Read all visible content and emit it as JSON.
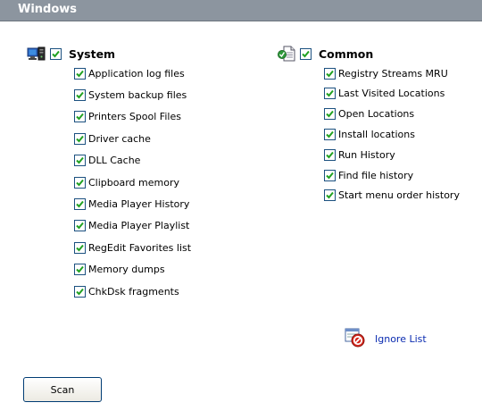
{
  "window": {
    "title": "Windows"
  },
  "system": {
    "header": "System",
    "icon": "computer-icon",
    "checked": true,
    "items": [
      {
        "label": "Application log files",
        "checked": true
      },
      {
        "label": "System backup files",
        "checked": true
      },
      {
        "label": "Printers Spool Files",
        "checked": true
      },
      {
        "label": "Driver cache",
        "checked": true
      },
      {
        "label": "DLL Cache",
        "checked": true
      },
      {
        "label": "Clipboard memory",
        "checked": true
      },
      {
        "label": "Media Player History",
        "checked": true
      },
      {
        "label": "Media Player Playlist",
        "checked": true
      },
      {
        "label": "RegEdit Favorites list",
        "checked": true
      },
      {
        "label": "Memory dumps",
        "checked": true
      },
      {
        "label": "ChkDsk fragments",
        "checked": true
      }
    ]
  },
  "common": {
    "header": "Common",
    "icon": "documents-icon",
    "checked": true,
    "items": [
      {
        "label": "Registry Streams MRU",
        "checked": true
      },
      {
        "label": "Last Visited Locations",
        "checked": true
      },
      {
        "label": "Open Locations",
        "checked": true
      },
      {
        "label": "Install locations",
        "checked": true
      },
      {
        "label": "Run History",
        "checked": true
      },
      {
        "label": "Find file history",
        "checked": true
      },
      {
        "label": "Start menu order history",
        "checked": true
      }
    ]
  },
  "ignore_list": {
    "label": "Ignore List",
    "icon": "ignore-list-icon"
  },
  "scan_button": {
    "label": "Scan"
  },
  "colors": {
    "titlebar": "#8c959f",
    "checkmark": "#21a121",
    "checkbox_border": "#1c5180",
    "link": "#0a2bb0"
  }
}
